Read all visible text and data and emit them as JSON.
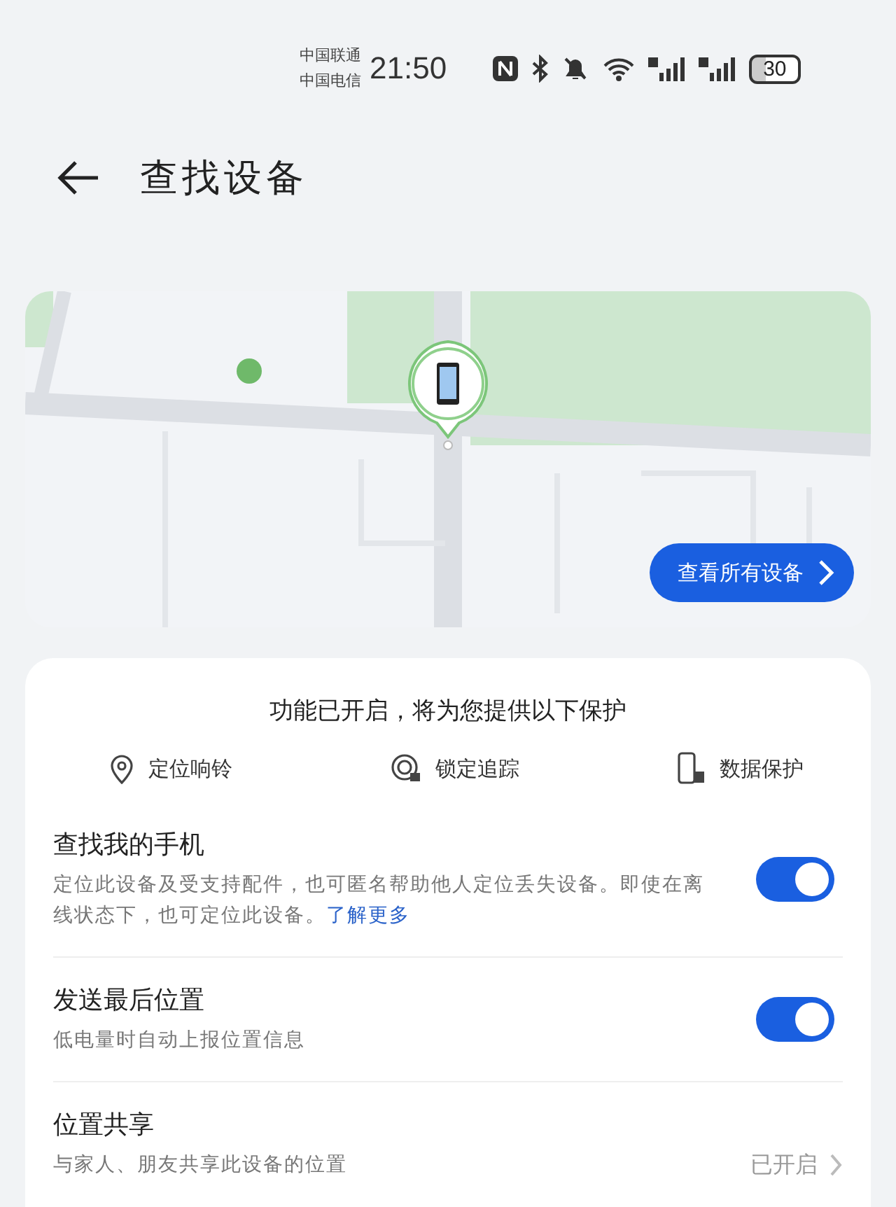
{
  "status_bar": {
    "carriers": [
      "中国联通",
      "中国电信"
    ],
    "time": "21:50",
    "battery": "30"
  },
  "header": {
    "title": "查找设备"
  },
  "map": {
    "kind": "picture",
    "button": "查看所有设备"
  },
  "protection": {
    "title": "功能已开启，将为您提供以下保护",
    "features": [
      {
        "kind": "location",
        "label": "定位响铃"
      },
      {
        "kind": "lock",
        "label": "锁定追踪"
      },
      {
        "kind": "data",
        "label": "数据保护"
      }
    ]
  },
  "settings": [
    {
      "kind": "toggle",
      "title": "查找我的手机",
      "description": "定位此设备及受支持配件，也可匿名帮助他人定位丢失设备。即使在离线状态下，也可定位此设备。",
      "link": "了解更多",
      "on": true
    },
    {
      "kind": "toggle",
      "title": "发送最后位置",
      "description": "低电量时自动上报位置信息",
      "on": true
    },
    {
      "kind": "link",
      "title": "位置共享",
      "description": "与家人、朋友共享此设备的位置",
      "value": "已开启"
    }
  ]
}
